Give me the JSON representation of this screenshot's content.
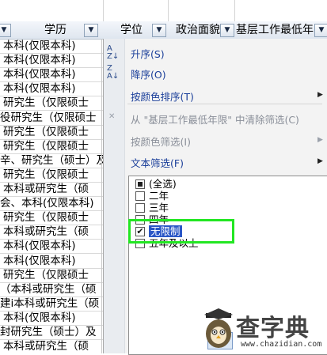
{
  "columns": [
    {
      "label": "学历"
    },
    {
      "label": "学位"
    },
    {
      "label": "政治面貌"
    },
    {
      "label": "基层工作最低年限"
    }
  ],
  "rows": [
    "本科(仅限本科)",
    "本科(仅限本科)",
    "本科(仅限本科)",
    "本科(仅限本科)",
    "研究生（仅限硕士",
    "研究生（仅限硕士",
    "研究生（仅限硕士",
    "研究生（仅限硕士",
    "研究生（硕士）及",
    "研究生（仅限硕士",
    "本科或研究生（硕",
    "本科(仅限本科)",
    "研究生（仅限硕士",
    "本科或研究生（硕",
    "本科(仅限本科)",
    "本科(仅限本科)",
    "研究生（仅限硕士",
    "本科或研究生（硕",
    "本科或研究生（硕",
    "本科(仅限本科)",
    "研究生（硕士）及",
    "本科或研究生（硕"
  ],
  "row_prefixes": {
    "5": "役",
    "8": "辛、",
    "11": "会、",
    "17": "（",
    "18": "建i",
    "20": "封"
  },
  "menu": {
    "sort_asc": "升序(S)",
    "sort_desc": "降序(O)",
    "sort_by_color": "按颜色排序(T)",
    "clear_filter": "从 \"基层工作最低年限\" 中清除筛选(C)",
    "filter_by_color": "按颜色筛选(I)",
    "text_filter": "文本筛选(F)"
  },
  "filter_items": [
    {
      "label": "(全选)",
      "state": "partial"
    },
    {
      "label": "二年",
      "state": "unchecked"
    },
    {
      "label": "三年",
      "state": "unchecked"
    },
    {
      "label": "四年",
      "state": "unchecked"
    },
    {
      "label": "无限制",
      "state": "checked"
    },
    {
      "label": "五年及以上",
      "state": "unchecked"
    }
  ],
  "watermark": {
    "title": "查字典",
    "url": "www.chazidian.com"
  },
  "colors": {
    "highlight_box": "#22e622",
    "selection": "#2a56c6",
    "menu_text": "#1b3f9a"
  }
}
